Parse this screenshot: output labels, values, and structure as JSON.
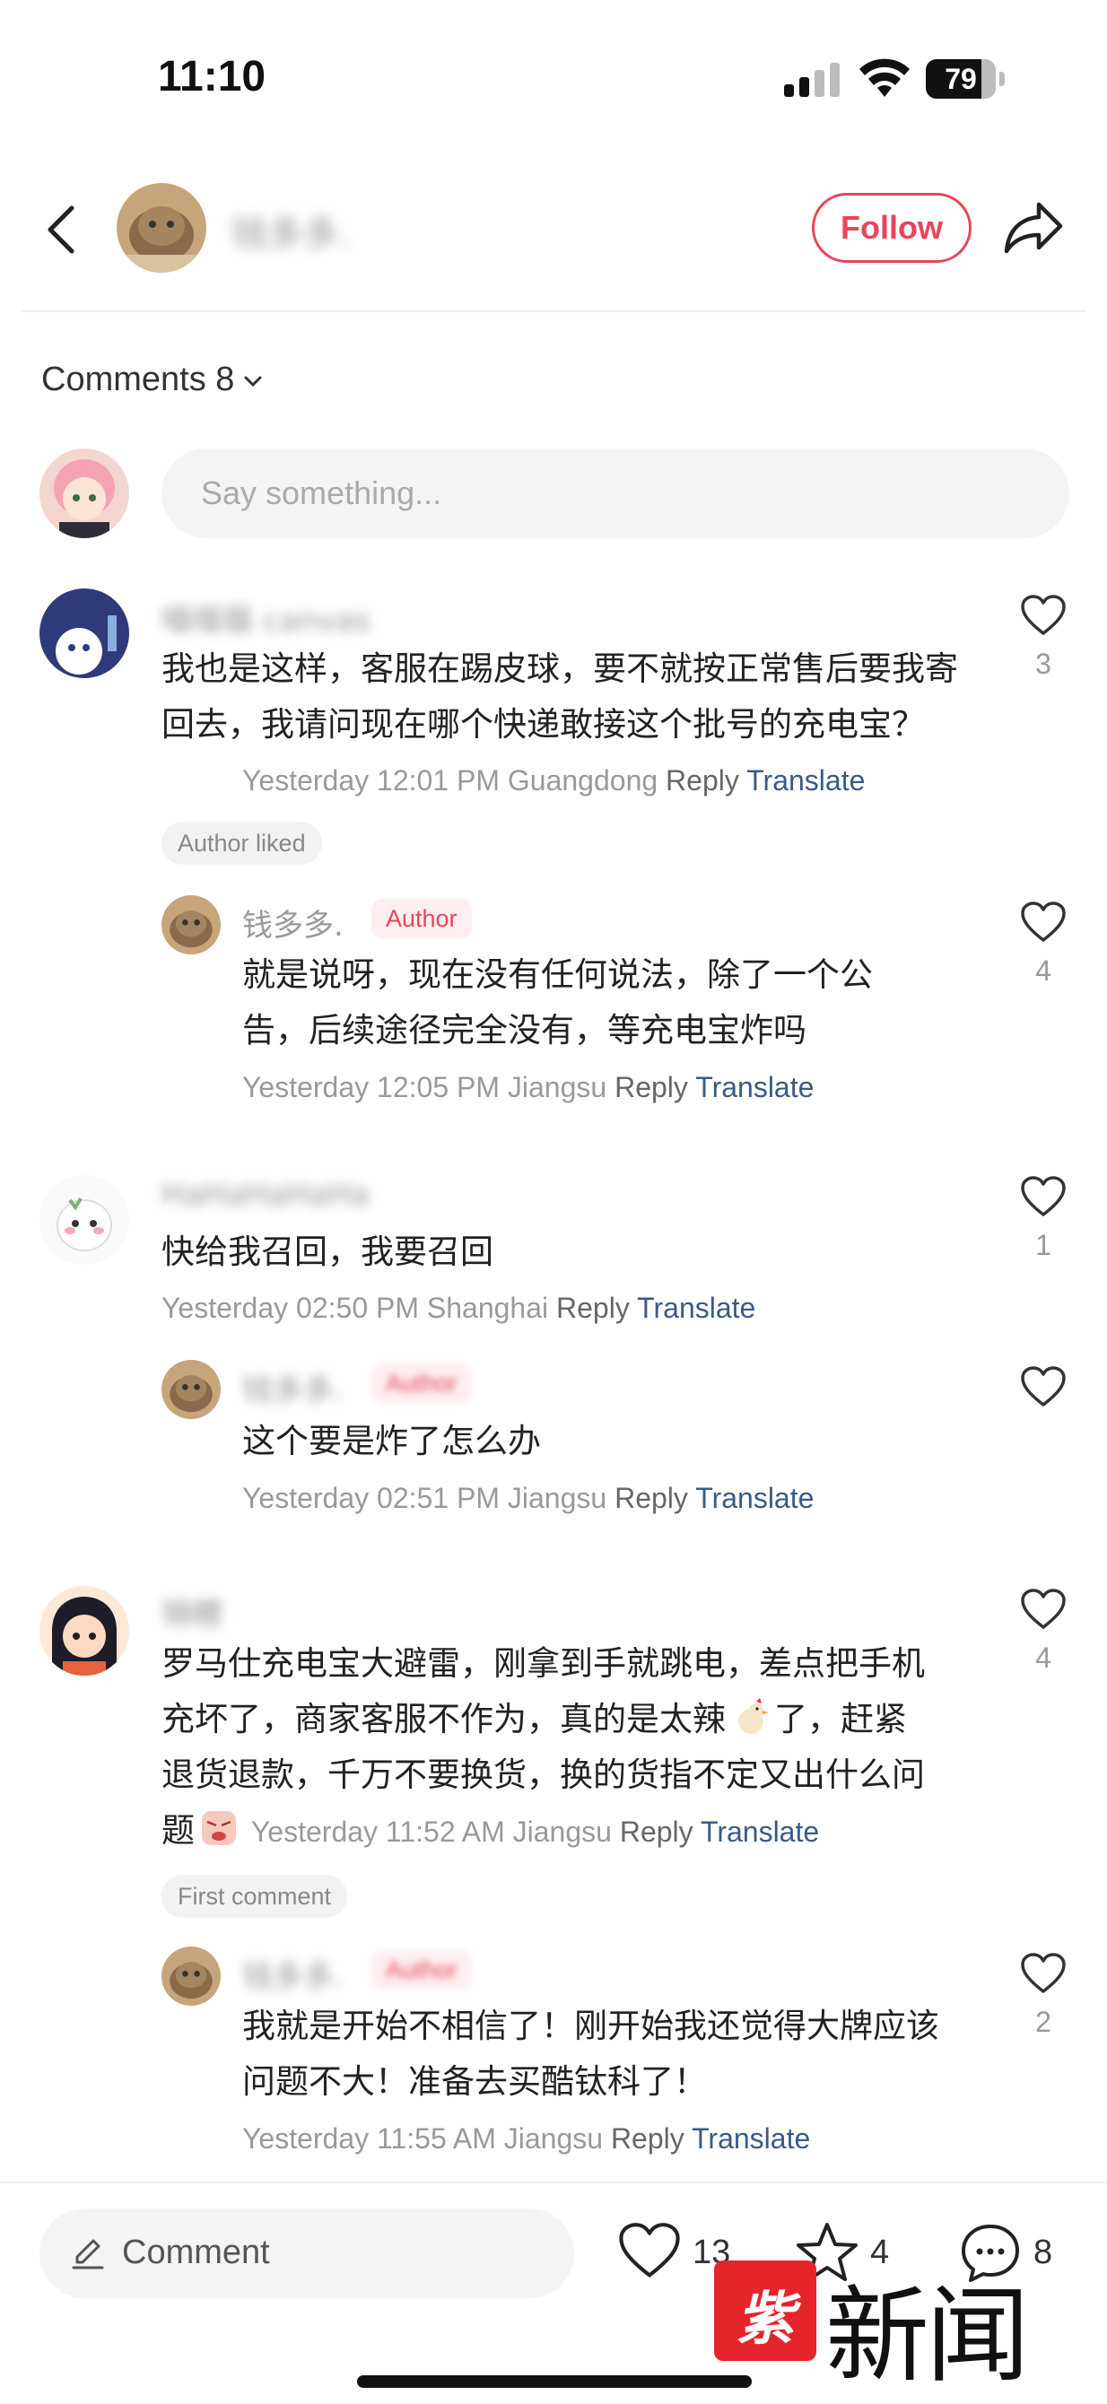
{
  "status_bar": {
    "time": "11:10",
    "battery": "79",
    "battery_level": 0.79
  },
  "header": {
    "user_name": "钱多多.",
    "follow_label": "Follow"
  },
  "comments_header": {
    "label": "Comments 8"
  },
  "composer": {
    "placeholder": "Say something..."
  },
  "comments": [
    {
      "user": "喵喵猫 canvas",
      "text": "我也是这样，客服在踢皮球，要不就按正常售后要我寄回去，我请问现在哪个快递敢接这个批号的充电宝？",
      "time": "Yesterday 12:01 PM",
      "location": "Guangdong",
      "reply": "Reply",
      "translate": "Translate",
      "likes": "3",
      "badge": "Author liked",
      "replies": [
        {
          "user": "钱多多.",
          "tag": "Author",
          "text": "就是说呀，现在没有任何说法，除了一个公告，后续途径完全没有，等充电宝炸吗",
          "time": "Yesterday 12:05 PM",
          "location": "Jiangsu",
          "reply": "Reply",
          "translate": "Translate",
          "likes": "4"
        }
      ]
    },
    {
      "user": "HaHaHaHaHa",
      "text": "快给我召回，我要召回",
      "time": "Yesterday 02:50 PM",
      "location": "Shanghai",
      "reply": "Reply",
      "translate": "Translate",
      "likes": "1",
      "replies": [
        {
          "user": "钱多多.",
          "tag": "Author",
          "text": "这个要是炸了怎么办",
          "time": "Yesterday 02:51 PM",
          "location": "Jiangsu",
          "reply": "Reply",
          "translate": "Translate",
          "likes": ""
        }
      ]
    },
    {
      "user": "锦鲤",
      "text_lines": [
        "罗马仕充电宝大避雷，刚拿到手就跳电，差点把手机",
        "充坏了，商家客服不作为，真的是太辣",
        "了，赶紧",
        "退货退款，千万不要换货，换的货指不定又出什么问",
        "题"
      ],
      "time": "Yesterday 11:52 AM",
      "location": "Jiangsu",
      "reply": "Reply",
      "translate": "Translate",
      "likes": "4",
      "badge": "First comment",
      "replies": [
        {
          "user": "钱多多.",
          "tag": "Author",
          "text": "我就是开始不相信了！刚开始我还觉得大牌应该问题不大！准备去买酷钛科了！",
          "time": "Yesterday 11:55 AM",
          "location": "Jiangsu",
          "reply": "Reply",
          "translate": "Translate",
          "likes": "2"
        }
      ]
    }
  ],
  "bottom_bar": {
    "comment_label": "Comment",
    "likes": "13",
    "collects": "4",
    "comments": "8"
  },
  "watermark": {
    "box_text": "紫牛",
    "text": "新闻"
  },
  "icons": {
    "back": "chevron-left-icon",
    "share": "share-arrow-icon",
    "heart": "heart-icon",
    "star": "star-icon",
    "comment": "speech-bubble-icon",
    "pencil": "pencil-icon"
  },
  "colors": {
    "accent": "#e8455a",
    "link": "#3b5a85",
    "muted": "#999999"
  }
}
